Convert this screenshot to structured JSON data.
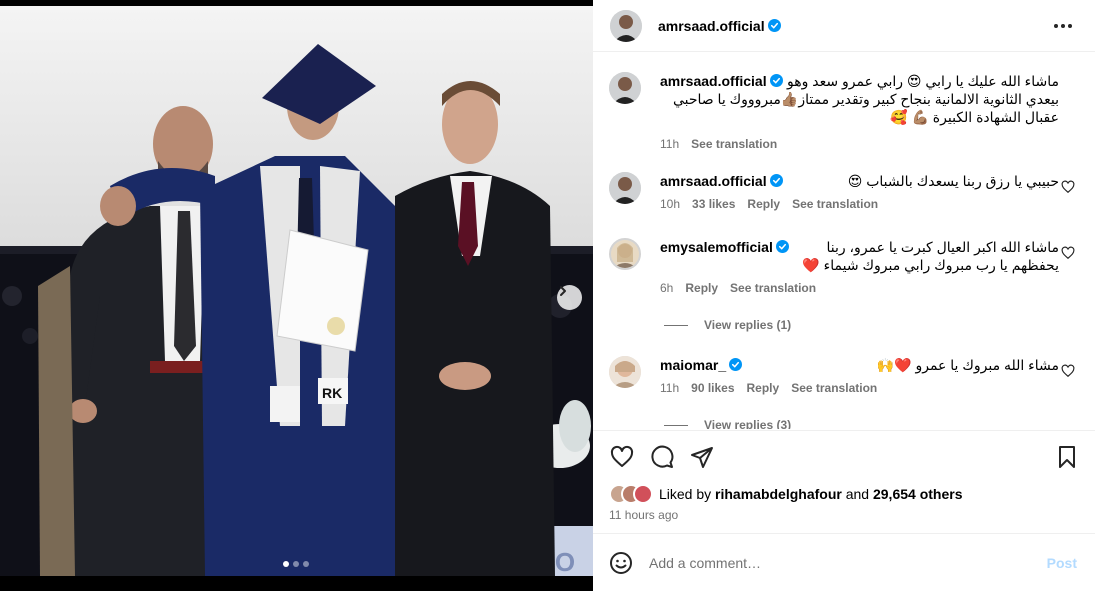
{
  "post": {
    "username": "amrsaad.official",
    "more_icon": "more-horizontal-icon",
    "carousel": {
      "slides": 3,
      "active_slide": 1,
      "next_icon": "chevron-right-icon"
    }
  },
  "caption": {
    "username": "amrsaad.official",
    "lines": [
      "ماشاء الله عليك يا رابي 😍 رابي عمرو سعد وهو",
      "بيعدي الثانوية الالمانية بنجاح كبير وتقدير ممتاز👍🏽مبروووك يا صاحبي",
      "عقبال الشهادة الكبيرة 💪🏽 🥰"
    ],
    "time": "11h",
    "see_translation": "See translation"
  },
  "comments": [
    {
      "username": "amrsaad.official",
      "lines": [
        "حبيبي يا رزق ربنا يسعدك بالشباب 😍"
      ],
      "time": "10h",
      "likes": "33 likes",
      "reply": "Reply",
      "see_translation": "See translation"
    },
    {
      "username": "emysalemofficial",
      "lines": [
        "ماشاء الله اكبر العيال كبرت يا عمرو، ربنا",
        "يحفظهم يا رب مبروك رابي مبروك شيماء ❤️"
      ],
      "time": "6h",
      "reply": "Reply",
      "see_translation": "See translation",
      "view_replies": "View replies (1)"
    },
    {
      "username": "maiomar_",
      "lines": [
        "مشاء الله مبروك يا عمرو ❤️🙌"
      ],
      "time": "11h",
      "likes": "90 likes",
      "reply": "Reply",
      "see_translation": "See translation",
      "view_replies": "View replies (3)"
    }
  ],
  "actions": {
    "like_icon": "heart-icon",
    "comment_icon": "comment-icon",
    "share_icon": "share-icon",
    "save_icon": "bookmark-icon"
  },
  "likes": {
    "prefix": "Liked by ",
    "user": "rihamabdelghafour",
    "and": " and ",
    "others": "29,654 others"
  },
  "timestamp": "11 hours ago",
  "add_comment": {
    "placeholder": "Add a comment…",
    "post_label": "Post",
    "emoji_icon": "emoji-icon"
  },
  "colors": {
    "verified_blue": "#0095f6",
    "muted": "#737373",
    "post_disabled": "#b3dbff"
  }
}
